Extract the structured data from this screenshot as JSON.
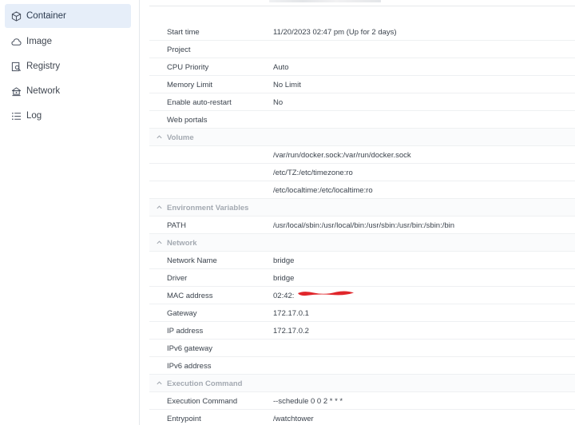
{
  "sidebar": {
    "items": [
      {
        "label": "Container",
        "icon": "container-icon",
        "active": true
      },
      {
        "label": "Image",
        "icon": "cloud-icon",
        "active": false
      },
      {
        "label": "Registry",
        "icon": "registry-icon",
        "active": false
      },
      {
        "label": "Network",
        "icon": "network-icon",
        "active": false
      },
      {
        "label": "Log",
        "icon": "list-icon",
        "active": false
      }
    ]
  },
  "details": {
    "start_time": {
      "label": "Start time",
      "value": "11/20/2023 02:47 pm (Up for 2 days)"
    },
    "project": {
      "label": "Project",
      "value": ""
    },
    "cpu_priority": {
      "label": "CPU Priority",
      "value": "Auto"
    },
    "memory_limit": {
      "label": "Memory Limit",
      "value": "No Limit"
    },
    "auto_restart": {
      "label": "Enable auto-restart",
      "value": "No"
    },
    "web_portals": {
      "label": "Web portals",
      "value": ""
    }
  },
  "volume": {
    "title": "Volume",
    "mounts": [
      "/var/run/docker.sock:/var/run/docker.sock",
      "/etc/TZ:/etc/timezone:ro",
      "/etc/localtime:/etc/localtime:ro"
    ]
  },
  "environment": {
    "title": "Environment Variables",
    "path": {
      "label": "PATH",
      "value": "/usr/local/sbin:/usr/local/bin:/usr/sbin:/usr/bin:/sbin:/bin"
    }
  },
  "network": {
    "title": "Network",
    "name": {
      "label": "Network Name",
      "value": "bridge"
    },
    "driver": {
      "label": "Driver",
      "value": "bridge"
    },
    "mac": {
      "label": "MAC address",
      "value": "02:42:"
    },
    "gateway": {
      "label": "Gateway",
      "value": "172.17.0.1"
    },
    "ip": {
      "label": "IP address",
      "value": "172.17.0.2"
    },
    "ipv6_gateway": {
      "label": "IPv6 gateway",
      "value": ""
    },
    "ipv6_address": {
      "label": "IPv6 address",
      "value": ""
    }
  },
  "execution": {
    "title": "Execution Command",
    "command": {
      "label": "Execution Command",
      "value": "--schedule 0 0 2 * * *"
    },
    "entrypoint": {
      "label": "Entrypoint",
      "value": "/watchtower"
    }
  },
  "colors": {
    "active_bg": "#e6eef9",
    "redaction": "#e0262b",
    "section_text": "#a3a9b1"
  }
}
